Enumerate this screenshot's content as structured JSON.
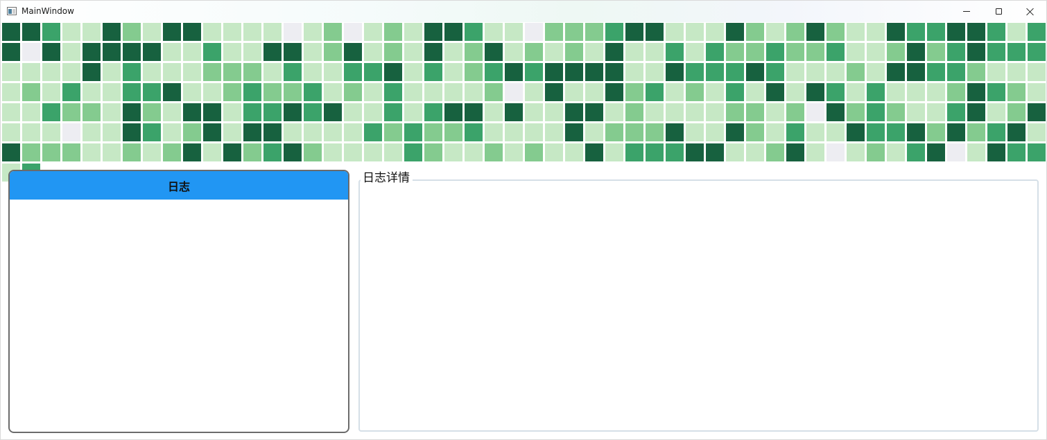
{
  "window": {
    "title": "MainWindow"
  },
  "caption_buttons": {
    "minimize_icon": "minimize-icon",
    "maximize_icon": "maximize-icon",
    "close_icon": "close-icon"
  },
  "heatmap": {
    "columns": 52,
    "palette": [
      "#ededf2",
      "#c6e8c5",
      "#84cb8f",
      "#3ba36a",
      "#17613f"
    ],
    "rows": [
      [
        4,
        4,
        3,
        1,
        1,
        4,
        2,
        1,
        4,
        4,
        1,
        1,
        1,
        1,
        0,
        1,
        2,
        0,
        1,
        2,
        1,
        4,
        4,
        3,
        1,
        1,
        0,
        2,
        2,
        2,
        3,
        4,
        4,
        1,
        1,
        1,
        4,
        2,
        1,
        2,
        4,
        2,
        1,
        1,
        4,
        3,
        3,
        4,
        4,
        3,
        1,
        3
      ],
      [
        4,
        0,
        4,
        1,
        4,
        4,
        4,
        4,
        1,
        1,
        3,
        1,
        1,
        4,
        4,
        1,
        2,
        4,
        1,
        2,
        1,
        4,
        1,
        2,
        4,
        1,
        2,
        1,
        2,
        1,
        4,
        1,
        1,
        3,
        1,
        3,
        2,
        2,
        3,
        2,
        2,
        3,
        1,
        1,
        2,
        4,
        2,
        3,
        4,
        3,
        3,
        3
      ],
      [
        1,
        1,
        1,
        1,
        4,
        1,
        3,
        1,
        1,
        1,
        2,
        2,
        2,
        1,
        3,
        1,
        1,
        3,
        3,
        4,
        1,
        3,
        1,
        2,
        3,
        4,
        3,
        4,
        4,
        4,
        4,
        1,
        1,
        4,
        3,
        3,
        3,
        4,
        3,
        1,
        1,
        1,
        2,
        1,
        4,
        4,
        3,
        3,
        2,
        1,
        1,
        1
      ],
      [
        1,
        2,
        1,
        3,
        1,
        1,
        3,
        3,
        4,
        1,
        1,
        2,
        3,
        2,
        2,
        3,
        1,
        2,
        1,
        3,
        1,
        1,
        1,
        1,
        2,
        0,
        1,
        4,
        1,
        1,
        4,
        2,
        3,
        1,
        2,
        1,
        3,
        1,
        4,
        1,
        4,
        3,
        1,
        3,
        1,
        1,
        1,
        2,
        4,
        3,
        2,
        1
      ],
      [
        1,
        1,
        3,
        2,
        2,
        1,
        4,
        2,
        1,
        4,
        4,
        1,
        3,
        3,
        4,
        3,
        4,
        1,
        1,
        3,
        1,
        3,
        4,
        4,
        1,
        4,
        1,
        1,
        4,
        4,
        1,
        2,
        1,
        1,
        1,
        1,
        2,
        2,
        1,
        2,
        0,
        4,
        2,
        3,
        2,
        1,
        1,
        3,
        4,
        1,
        2,
        4
      ],
      [
        1,
        1,
        1,
        0,
        1,
        1,
        4,
        3,
        1,
        2,
        4,
        1,
        4,
        4,
        1,
        1,
        1,
        1,
        3,
        2,
        3,
        2,
        2,
        3,
        1,
        1,
        1,
        1,
        4,
        1,
        2,
        2,
        2,
        4,
        1,
        1,
        4,
        2,
        1,
        3,
        1,
        1,
        4,
        3,
        3,
        4,
        2,
        4,
        2,
        3,
        4,
        1,
        4
      ],
      [
        2,
        2,
        2,
        1,
        1,
        2,
        1,
        2,
        4,
        1,
        4,
        2,
        3,
        4,
        2,
        1,
        1,
        1,
        1,
        3,
        2,
        1,
        1,
        2,
        1,
        2,
        1,
        1,
        4,
        1,
        3,
        3,
        3,
        4,
        4,
        1,
        1,
        2,
        4,
        1,
        0,
        1,
        2,
        1,
        3,
        4,
        0,
        1,
        4,
        3,
        3,
        1,
        3
      ]
    ]
  },
  "log_panel": {
    "header": "日志",
    "entries": []
  },
  "detail_panel": {
    "legend": "日志详情",
    "content": ""
  }
}
